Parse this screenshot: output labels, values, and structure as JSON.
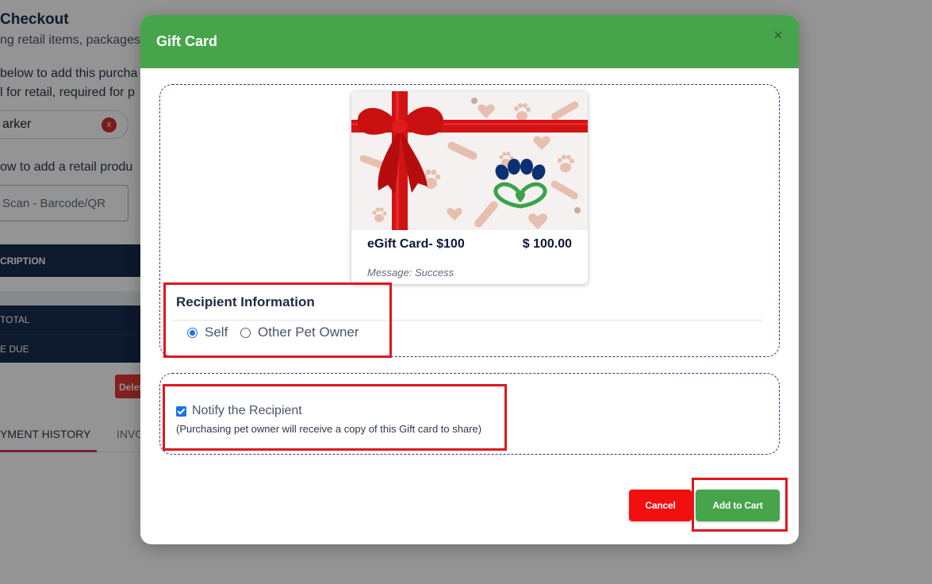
{
  "background": {
    "title": "Checkout",
    "subtitle": "ng retail items, packages",
    "instruction_1": "below to add this purcha",
    "instruction_2": "l for retail, required for p",
    "client_chip": "arker",
    "client_clear": "x",
    "instruction_3": "ow to add a retail produ",
    "scan_placeholder": "Scan - Barcode/QR",
    "table_header": "CRIPTION",
    "total_label": "TOTAL",
    "due_label": "E DUE",
    "delete_label": "Delet",
    "tabs": [
      "YMENT HISTORY",
      "INVO"
    ]
  },
  "modal": {
    "title": "Gift Card",
    "close_glyph": "×",
    "card": {
      "name": "eGift Card- $100",
      "price": "$ 100.00",
      "message_label": "Message:",
      "message_value": "Success"
    },
    "recipient": {
      "title": "Recipient Information",
      "options": [
        {
          "label": "Self",
          "selected": true
        },
        {
          "label": "Other Pet Owner",
          "selected": false
        }
      ]
    },
    "notify": {
      "label": "Notify the Recipient",
      "checked": true,
      "note": "(Purchasing pet owner will receive a copy of this Gift card to share)"
    },
    "buttons": {
      "cancel": "Cancel",
      "add_to_cart": "Add to Cart"
    }
  },
  "colors": {
    "header_green": "#46a54a",
    "cancel_red": "#f10f0f",
    "highlight_red": "#e0161b",
    "navy": "#172b4d",
    "radio_blue": "#1a73e8"
  },
  "icons": {
    "close": "close-icon",
    "client_clear": "clear-icon",
    "card_logo": "paw-heart-logo"
  }
}
